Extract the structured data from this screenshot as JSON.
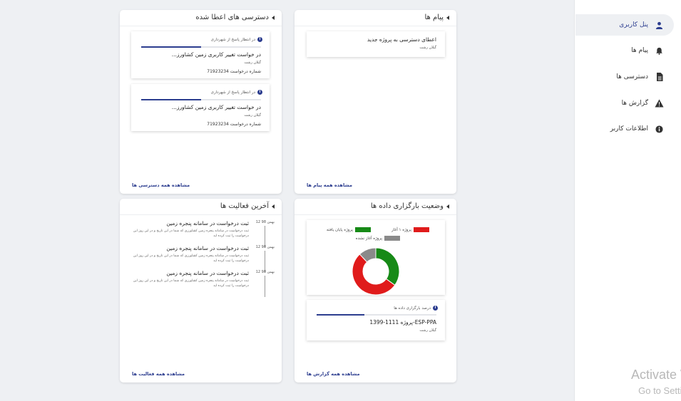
{
  "sidebar": {
    "items": [
      {
        "label": "پنل کاربری",
        "icon": "user-icon",
        "active": true
      },
      {
        "label": "پیام ها",
        "icon": "bell-icon",
        "active": false
      },
      {
        "label": "دسترسی ها",
        "icon": "document-icon",
        "active": false
      },
      {
        "label": "گزارش ها",
        "icon": "warning-icon",
        "active": false
      },
      {
        "label": "اطلاعات کاربر",
        "icon": "info-icon",
        "active": false
      }
    ]
  },
  "messages": {
    "title": "پیام ها",
    "item": {
      "title": "اعطای دسترسی به پروژه جدید",
      "location": "گیلان رشت"
    },
    "footer": "مشاهده همه پیام ها"
  },
  "access": {
    "title": "دسترسی های اعطا شده",
    "items": [
      {
        "status": "در انتظار پاسخ از شهرداری",
        "title": "در خواست تغییر کاربری زمین کشاورز...",
        "location": "گیلان رشت",
        "number": "شماره درخواست 71923234",
        "progress": 0.5
      },
      {
        "status": "در انتظار پاسخ از شهرداری",
        "title": "در خواست تغییر کاربری زمین کشاورز...",
        "location": "گیلان رشت",
        "number": "شماره درخواست 71923234",
        "progress": 0.5
      }
    ],
    "footer": "مشاهده همه دسترسی ها"
  },
  "upload": {
    "title": "وضعیت بارگزاری داده ها",
    "legend": [
      {
        "label": "پروژه ۱ آغاز",
        "color": "#e01b1b"
      },
      {
        "label": "پروژه پایان یافته",
        "color": "#178a17"
      },
      {
        "label": "پروژه آغاز نشده",
        "color": "#8a8a8a"
      }
    ],
    "project": {
      "status": "درصد بارگزاری داده ها",
      "title": "پروژه 1111-1399-ESP-PPA",
      "location": "گیلان رشت",
      "progress": 0.4
    },
    "footer": "مشاهده همه گزارش ها"
  },
  "chart_data": {
    "type": "pie",
    "categories": [
      "پروژه پایان یافته",
      "پروژه ۱ آغاز",
      "پروژه آغاز نشده"
    ],
    "values": [
      35,
      53,
      12
    ],
    "colors": [
      "#178a17",
      "#e01b1b",
      "#8a8a8a"
    ]
  },
  "activity": {
    "title": "آخرین فعالیت ها",
    "items": [
      {
        "date": "12 بهمن 98",
        "title": "ثبت درخواست در سامانه پنجره زمین",
        "desc": "ثبت درخواست در سامانه پنجره زمین کشاورزی که شما در این تاریخ و در این روز این درخواست را ثبت کرده اید"
      },
      {
        "date": "12 بهمن 98",
        "title": "ثبت درخواست در سامانه پنجره زمین",
        "desc": "ثبت درخواست در سامانه پنجره زمین کشاورزی که شما در این تاریخ و در این روز این درخواست را ثبت کرده اید"
      },
      {
        "date": "12 بهمن 98",
        "title": "ثبت درخواست در سامانه پنجره زمین",
        "desc": "ثبت درخواست در سامانه پنجره زمین کشاورزی که شما در این تاریخ و در این روز این درخواست را ثبت کرده اید"
      }
    ],
    "footer": "مشاهده همه فعالیت ها"
  },
  "watermark": {
    "line1": "Activate W",
    "line2": "Go to Setting"
  }
}
